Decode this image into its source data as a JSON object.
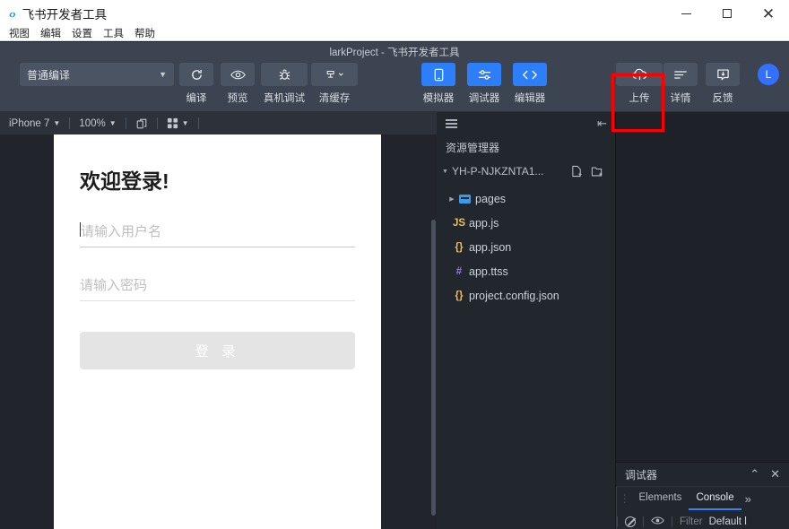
{
  "window": {
    "app_title": "飞书开发者工具",
    "logo_text": "‹›",
    "controls": {
      "minimize": "minimize-icon",
      "maximize": "maximize-icon",
      "close": "close-icon"
    }
  },
  "menubar": {
    "items": [
      {
        "label": "视图"
      },
      {
        "label": "编辑"
      },
      {
        "label": "设置"
      },
      {
        "label": "工具"
      },
      {
        "label": "帮助"
      }
    ]
  },
  "toolbar": {
    "project_title": "larkProject - 飞书开发者工具",
    "compile_mode": {
      "value": "普通编译",
      "chevron": "chevron-down-icon"
    },
    "left_buttons": [
      {
        "label": "编译",
        "icon": "refresh-icon",
        "glyph": "⟳",
        "style": "gray"
      },
      {
        "label": "预览",
        "icon": "eye-icon",
        "glyph": "◉",
        "style": "gray"
      },
      {
        "label": "真机调试",
        "icon": "bug-icon",
        "glyph": "🐞",
        "style": "gray"
      },
      {
        "label": "清缓存",
        "icon": "broom-icon",
        "glyph": "⌹",
        "style": "gray"
      }
    ],
    "center_buttons": [
      {
        "label": "模拟器",
        "icon": "phone-icon",
        "glyph": "▯",
        "style": "blue"
      },
      {
        "label": "调试器",
        "icon": "sliders-icon",
        "glyph": "⚙",
        "style": "blue"
      },
      {
        "label": "编辑器",
        "icon": "code-icon",
        "glyph": "‹›",
        "style": "blue"
      }
    ],
    "right_buttons": [
      {
        "label": "上传",
        "icon": "cloud-upload-icon",
        "glyph": "☁",
        "style": "gray",
        "highlighted": true
      },
      {
        "label": "详情",
        "icon": "details-icon",
        "glyph": "≡",
        "style": "gray"
      },
      {
        "label": "反馈",
        "icon": "feedback-icon",
        "glyph": "▣",
        "style": "gray"
      }
    ],
    "avatar": {
      "initial": "L"
    },
    "highlight_color": "#ff0000"
  },
  "simulator": {
    "toolbar": {
      "device": "iPhone 7",
      "zoom": "100%",
      "rotate_icon": "rotate-device-icon",
      "grid_icon": "grid-icon",
      "chevron": "chevron-down-icon"
    },
    "screen": {
      "title": "欢迎登录!",
      "username_placeholder": "请输入用户名",
      "password_placeholder": "请输入密码",
      "login_button": "登 录",
      "focus_color": "#a5e3ad",
      "button_color": "#e4e4e4"
    }
  },
  "explorer": {
    "header": {
      "list_icon": "list-icon",
      "collapse_icon": "collapse-panel-icon"
    },
    "title": "资源管理器",
    "project": {
      "name": "YH-P-NJKZNTA1...",
      "triangle": "triangle-down-icon",
      "new_file_icon": "new-file-icon",
      "new_folder_icon": "new-folder-icon"
    },
    "tree": [
      {
        "name": "pages",
        "type": "folder",
        "icon": "folder-icon",
        "badge": "",
        "expanded": false
      },
      {
        "name": "app.js",
        "type": "file",
        "icon": "js-file-icon",
        "badge": "JS",
        "color_class": "c-js"
      },
      {
        "name": "app.json",
        "type": "file",
        "icon": "json-file-icon",
        "badge": "{}",
        "color_class": "c-json"
      },
      {
        "name": "app.ttss",
        "type": "file",
        "icon": "style-file-icon",
        "badge": "#",
        "color_class": "c-ttss"
      },
      {
        "name": "project.config.json",
        "type": "file",
        "icon": "json-file-icon",
        "badge": "{}",
        "color_class": "c-json"
      }
    ]
  },
  "debugger": {
    "title": "调试器",
    "collapse_icon": "chevron-up-icon",
    "close_icon": "close-icon",
    "tabs": [
      {
        "label": "Elements",
        "active": false
      },
      {
        "label": "Console",
        "active": true
      }
    ],
    "more_icon": "more-tabs-icon",
    "console_toolbar": {
      "clear_icon": "clear-console-icon",
      "eye_icon": "eye-icon",
      "filter_placeholder": "Filter",
      "level": "Default l"
    }
  }
}
